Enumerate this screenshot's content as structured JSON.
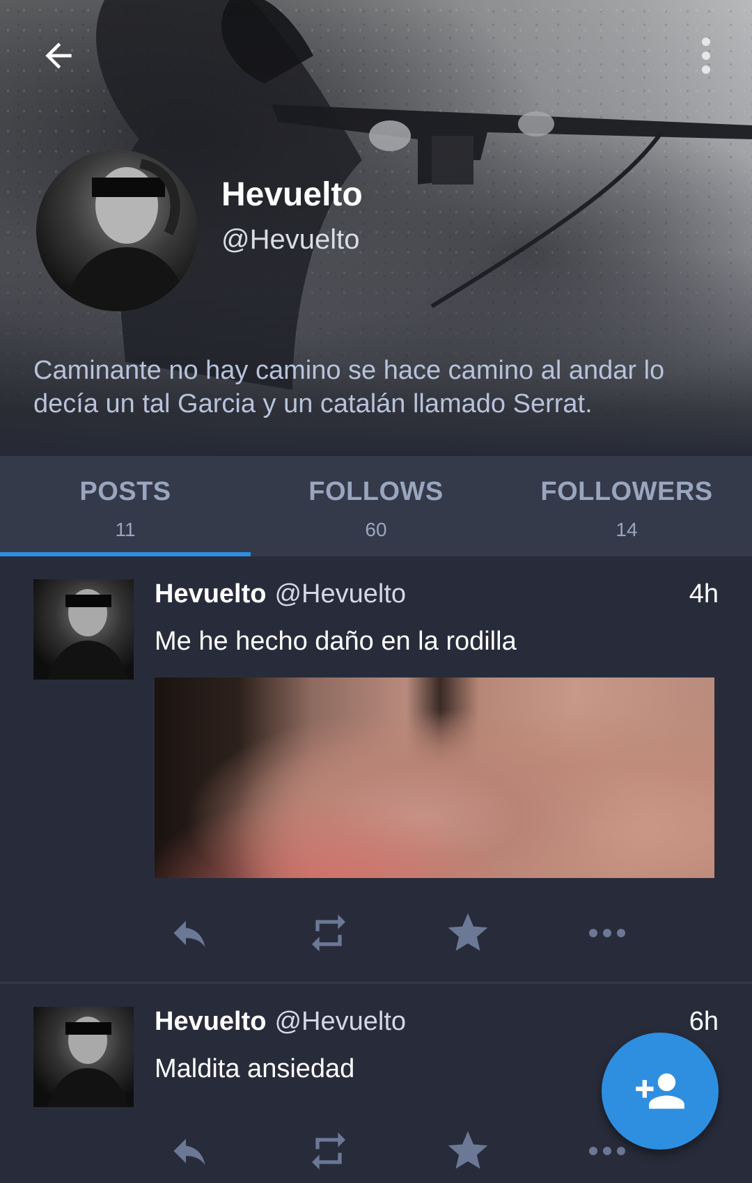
{
  "header": {
    "back_icon": "arrow-left-icon",
    "more_icon": "more-vertical-icon"
  },
  "profile": {
    "name": "Hevuelto",
    "handle": "@Hevuelto",
    "bio": "Caminante no hay camino se hace camino al andar lo decía un tal Garcia y un catalán llamado Serrat."
  },
  "tabs": [
    {
      "label": "POSTS",
      "count": "11",
      "active": true
    },
    {
      "label": "FOLLOWS",
      "count": "60",
      "active": false
    },
    {
      "label": "FOLLOWERS",
      "count": "14",
      "active": false
    }
  ],
  "posts": [
    {
      "name": "Hevuelto",
      "handle": "@Hevuelto",
      "time": "4h",
      "text": "Me he hecho daño en la rodilla",
      "has_media": true
    },
    {
      "name": "Hevuelto",
      "handle": "@Hevuelto",
      "time": "6h",
      "text": "Maldita ansiedad",
      "has_media": false
    }
  ],
  "actions": [
    "reply-icon",
    "repost-icon",
    "star-icon",
    "more-horizontal-icon"
  ],
  "fab": {
    "icon": "add-user-icon"
  },
  "colors": {
    "accent": "#2d8fdf",
    "background": "#282c3a",
    "tab_bar": "#353a4a",
    "muted_text": "#9aa6bf",
    "icon": "#6b7896"
  }
}
